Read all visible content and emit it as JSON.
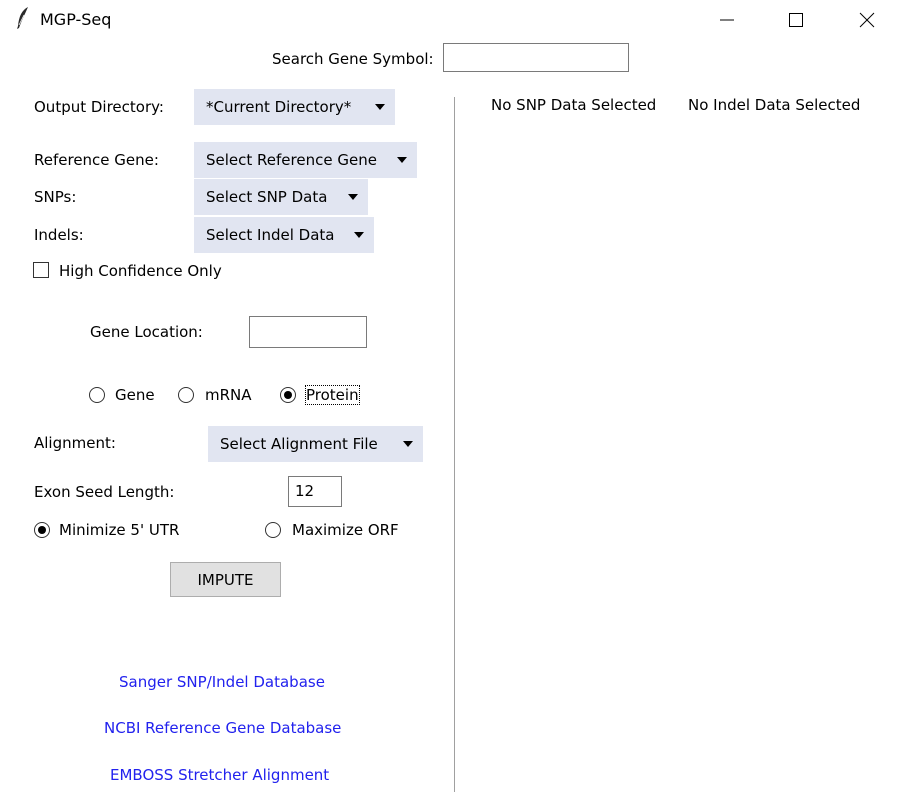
{
  "window": {
    "title": "MGP-Seq",
    "controls": [
      "minimize",
      "maximize",
      "close"
    ]
  },
  "search": {
    "label": "Search Gene Symbol:",
    "value": ""
  },
  "output_dir": {
    "label": "Output Directory:",
    "selected": "*Current Directory*"
  },
  "reference_gene": {
    "label": "Reference Gene:",
    "selected": "Select Reference Gene"
  },
  "snps": {
    "label": "SNPs:",
    "selected": "Select SNP Data"
  },
  "indels": {
    "label": "Indels:",
    "selected": "Select Indel Data"
  },
  "high_confidence": {
    "label": "High Confidence Only",
    "checked": false
  },
  "gene_location": {
    "label": "Gene Location:",
    "value": ""
  },
  "sequence_type": {
    "options": [
      "Gene",
      "mRNA",
      "Protein"
    ],
    "selected": "Protein"
  },
  "alignment": {
    "label": "Alignment:",
    "selected": "Select Alignment File"
  },
  "exon_seed": {
    "label": "Exon Seed Length:",
    "value": "12"
  },
  "utr_mode": {
    "options": [
      "Minimize 5' UTR",
      "Maximize ORF"
    ],
    "selected": "Minimize 5' UTR"
  },
  "impute_button": "IMPUTE",
  "links": [
    "Sanger SNP/Indel Database",
    "NCBI Reference Gene Database",
    "EMBOSS Stretcher Alignment"
  ],
  "right_panel": {
    "snp_status": "No SNP Data Selected",
    "indel_status": "No Indel Data Selected"
  },
  "colors": {
    "option_menu_bg": "#e1e5f1",
    "link": "#2222ee",
    "button_bg": "#e1e1e1"
  }
}
